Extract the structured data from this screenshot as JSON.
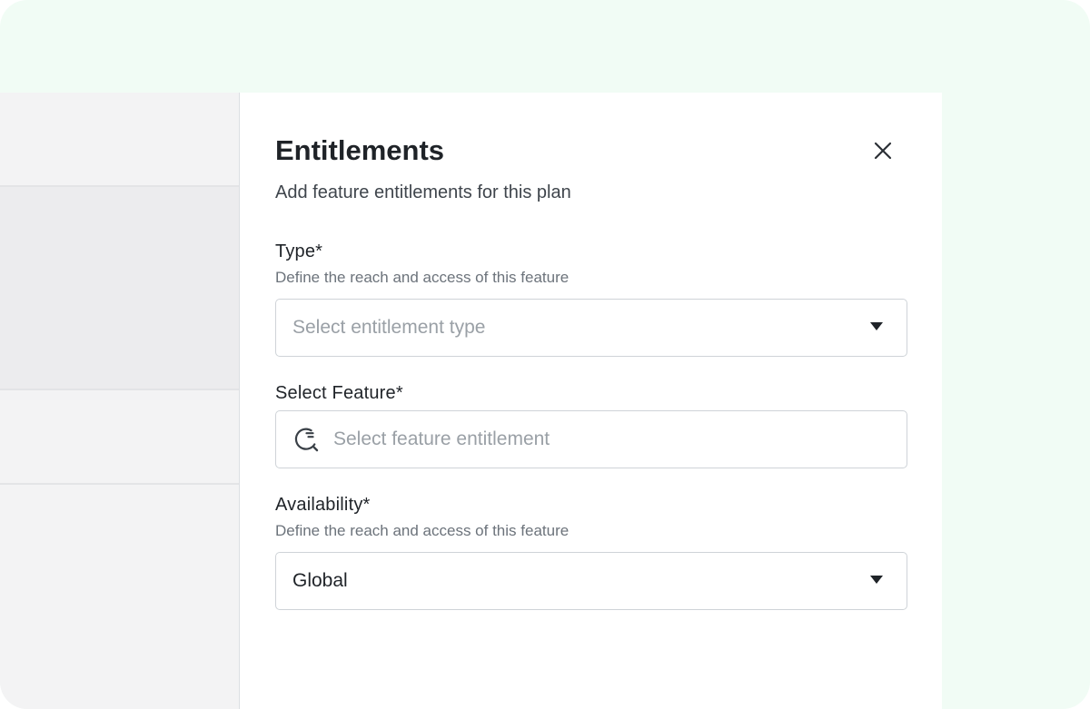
{
  "drawer": {
    "title": "Entitlements",
    "subtitle": "Add feature entitlements for this plan"
  },
  "fields": {
    "type": {
      "label": "Type*",
      "hint": "Define the reach and access of this feature",
      "placeholder": "Select entitlement type"
    },
    "feature": {
      "label": "Select Feature*",
      "placeholder": "Select feature entitlement"
    },
    "availability": {
      "label": "Availability*",
      "hint": "Define the reach and access of this feature",
      "value": "Global"
    }
  },
  "icons": {
    "close": "close-icon",
    "caret": "caret-down-icon",
    "search": "search-icon"
  },
  "colors": {
    "outer_background": "#f1fcf5",
    "text_primary": "#1f2328",
    "text_secondary": "#6c737b",
    "placeholder": "#9aa0a6",
    "border": "#cfd3d8"
  }
}
